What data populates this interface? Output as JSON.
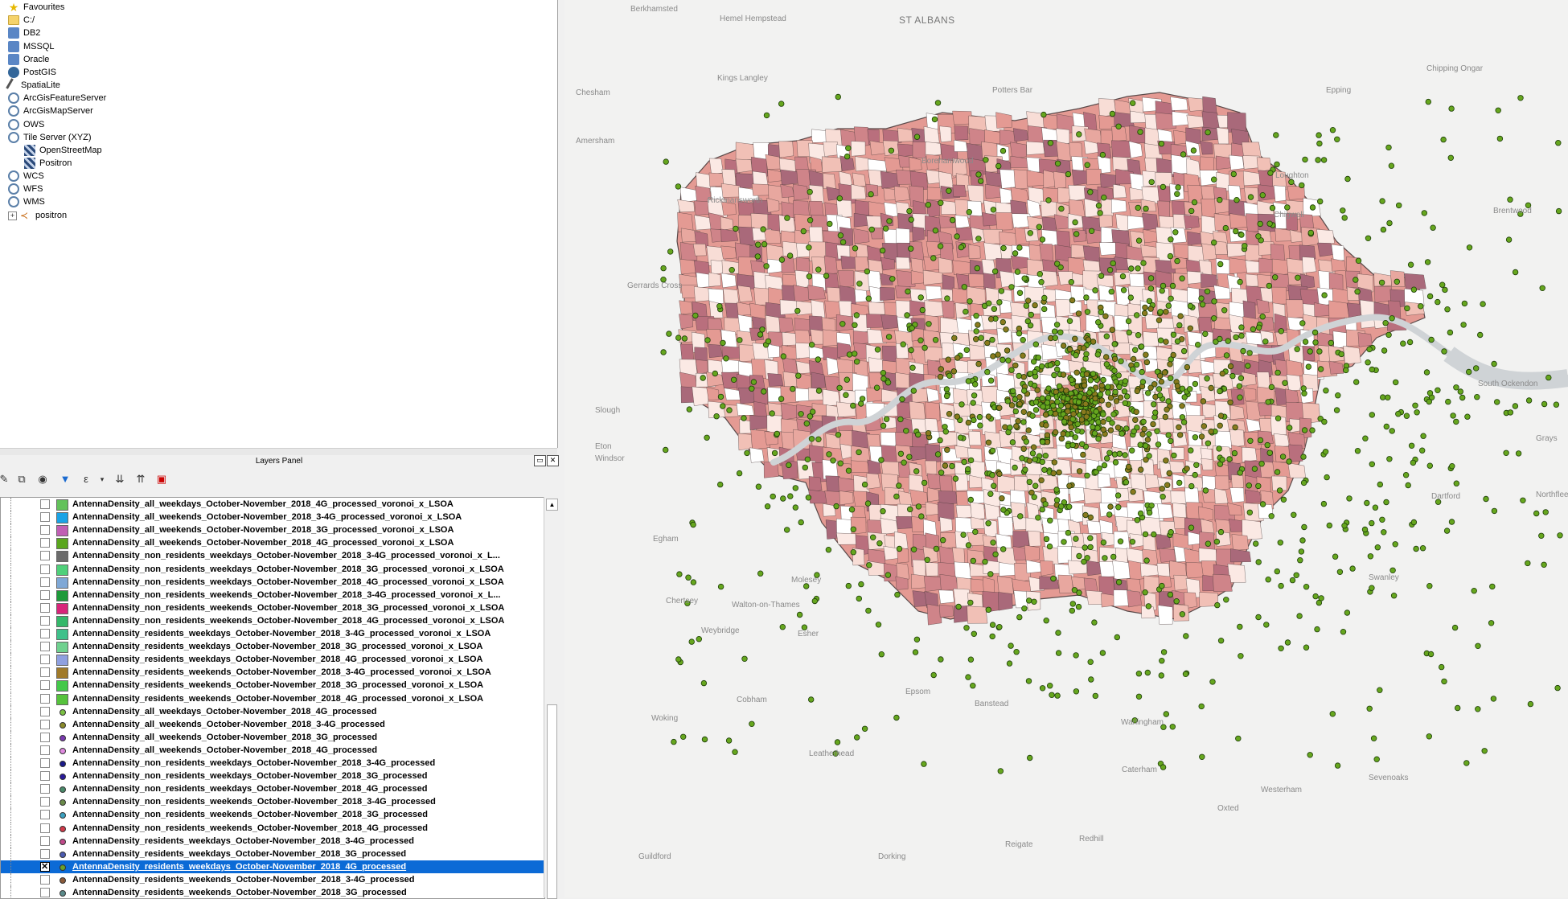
{
  "browser": {
    "items": [
      {
        "label": "Favourites",
        "icon": "star-icon"
      },
      {
        "label": "C:/",
        "icon": "folder-icon"
      },
      {
        "label": "DB2",
        "icon": "db2-icon"
      },
      {
        "label": "MSSQL",
        "icon": "mssql-icon"
      },
      {
        "label": "Oracle",
        "icon": "oracle-icon"
      },
      {
        "label": "PostGIS",
        "icon": "postgis-icon"
      },
      {
        "label": "SpatiaLite",
        "icon": "spatialite-icon"
      },
      {
        "label": "ArcGisFeatureServer",
        "icon": "arcgis-icon"
      },
      {
        "label": "ArcGisMapServer",
        "icon": "arcgis-icon"
      },
      {
        "label": "OWS",
        "icon": "globe-icon"
      },
      {
        "label": "Tile Server (XYZ)",
        "icon": "globe-icon"
      },
      {
        "label": "OpenStreetMap",
        "icon": "tile-icon"
      },
      {
        "label": "Positron",
        "icon": "tile-icon"
      },
      {
        "label": "WCS",
        "icon": "globe-icon"
      },
      {
        "label": "WFS",
        "icon": "globe-icon"
      },
      {
        "label": "WMS",
        "icon": "globe-icon"
      },
      {
        "label": "positron",
        "icon": "link-icon"
      }
    ]
  },
  "layers_panel": {
    "title": "Layers Panel",
    "rows": [
      {
        "label": "AntennaDensity_all_weekdays_October-November_2018_4G_processed_voronoi_x_LSOA",
        "swatch": "#63c25b",
        "kind": "poly",
        "checked": false
      },
      {
        "label": "AntennaDensity_all_weekends_October-November_2018_3-4G_processed_voronoi_x_LSOA",
        "swatch": "#1aa3e6",
        "kind": "poly",
        "checked": false
      },
      {
        "label": "AntennaDensity_all_weekends_October-November_2018_3G_processed_voronoi_x_LSOA",
        "swatch": "#c05fb4",
        "kind": "poly",
        "checked": false
      },
      {
        "label": "AntennaDensity_all_weekends_October-November_2018_4G_processed_voronoi_x_LSOA",
        "swatch": "#5aa61e",
        "kind": "poly",
        "checked": false
      },
      {
        "label": "AntennaDensity_non_residents_weekdays_October-November_2018_3-4G_processed_voronoi_x_L...",
        "swatch": "#6b6b6b",
        "kind": "poly",
        "checked": false
      },
      {
        "label": "AntennaDensity_non_residents_weekdays_October-November_2018_3G_processed_voronoi_x_LSOA",
        "swatch": "#4fd07a",
        "kind": "poly",
        "checked": false
      },
      {
        "label": "AntennaDensity_non_residents_weekdays_October-November_2018_4G_processed_voronoi_x_LSOA",
        "swatch": "#7fa8d6",
        "kind": "poly",
        "checked": false
      },
      {
        "label": "AntennaDensity_non_residents_weekends_October-November_2018_3-4G_processed_voronoi_x_L...",
        "swatch": "#1e9a3a",
        "kind": "poly",
        "checked": false
      },
      {
        "label": "AntennaDensity_non_residents_weekends_October-November_2018_3G_processed_voronoi_x_LSOA",
        "swatch": "#d8257a",
        "kind": "poly",
        "checked": false
      },
      {
        "label": "AntennaDensity_non_residents_weekends_October-November_2018_4G_processed_voronoi_x_LSOA",
        "swatch": "#34b86a",
        "kind": "poly",
        "checked": false
      },
      {
        "label": "AntennaDensity_residents_weekdays_October-November_2018_3-4G_processed_voronoi_x_LSOA",
        "swatch": "#3fc08a",
        "kind": "poly",
        "checked": false
      },
      {
        "label": "AntennaDensity_residents_weekdays_October-November_2018_3G_processed_voronoi_x_LSOA",
        "swatch": "#6fd18f",
        "kind": "poly",
        "checked": false
      },
      {
        "label": "AntennaDensity_residents_weekdays_October-November_2018_4G_processed_voronoi_x_LSOA",
        "swatch": "#8fa0e0",
        "kind": "poly",
        "checked": false
      },
      {
        "label": "AntennaDensity_residents_weekends_October-November_2018_3-4G_processed_voronoi_x_LSOA",
        "swatch": "#a07a2a",
        "kind": "poly",
        "checked": false
      },
      {
        "label": "AntennaDensity_residents_weekends_October-November_2018_3G_processed_voronoi_x_LSOA",
        "swatch": "#44c84a",
        "kind": "poly",
        "checked": false
      },
      {
        "label": "AntennaDensity_residents_weekends_October-November_2018_4G_processed_voronoi_x_LSOA",
        "swatch": "#56c23c",
        "kind": "poly",
        "checked": false
      },
      {
        "label": "AntennaDensity_all_weekdays_October-November_2018_4G_processed",
        "swatch": "#7bc043",
        "kind": "point",
        "checked": false
      },
      {
        "label": "AntennaDensity_all_weekends_October-November_2018_3-4G_processed",
        "swatch": "#8a8a2a",
        "kind": "point",
        "checked": false
      },
      {
        "label": "AntennaDensity_all_weekends_October-November_2018_3G_processed",
        "swatch": "#7a3ab0",
        "kind": "point",
        "checked": false
      },
      {
        "label": "AntennaDensity_all_weekends_October-November_2018_4G_processed",
        "swatch": "#e08ae0",
        "kind": "point",
        "checked": false
      },
      {
        "label": "AntennaDensity_non_residents_weekdays_October-November_2018_3-4G_processed",
        "swatch": "#1a1a8a",
        "kind": "point",
        "checked": false
      },
      {
        "label": "AntennaDensity_non_residents_weekdays_October-November_2018_3G_processed",
        "swatch": "#2a1a9a",
        "kind": "point",
        "checked": false
      },
      {
        "label": "AntennaDensity_non_residents_weekdays_October-November_2018_4G_processed",
        "swatch": "#4a8a6a",
        "kind": "point",
        "checked": false
      },
      {
        "label": "AntennaDensity_non_residents_weekends_October-November_2018_3-4G_processed",
        "swatch": "#6a8a4a",
        "kind": "point",
        "checked": false
      },
      {
        "label": "AntennaDensity_non_residents_weekends_October-November_2018_3G_processed",
        "swatch": "#3aa0c0",
        "kind": "point",
        "checked": false
      },
      {
        "label": "AntennaDensity_non_residents_weekends_October-November_2018_4G_processed",
        "swatch": "#d03a4a",
        "kind": "point",
        "checked": false
      },
      {
        "label": "AntennaDensity_residents_weekdays_October-November_2018_3-4G_processed",
        "swatch": "#c04a8a",
        "kind": "point",
        "checked": false
      },
      {
        "label": "AntennaDensity_residents_weekdays_October-November_2018_3G_processed",
        "swatch": "#4a5ab0",
        "kind": "point",
        "checked": false
      },
      {
        "label": "AntennaDensity_residents_weekdays_October-November_2018_4G_processed",
        "swatch": "#6aa02a",
        "kind": "point",
        "checked": true,
        "selected": true
      },
      {
        "label": "AntennaDensity_residents_weekends_October-November_2018_3-4G_processed",
        "swatch": "#8a5a3a",
        "kind": "point",
        "checked": false
      },
      {
        "label": "AntennaDensity_residents_weekends_October-November_2018_3G_processed",
        "swatch": "#5a8a8a",
        "kind": "point",
        "checked": false
      }
    ]
  },
  "map": {
    "colors": {
      "background": "#f2f2f1",
      "polygon_light": "#f8ddd6",
      "polygon_mid": "#e49a93",
      "polygon_dark": "#b96f7d",
      "river": "#cfd3d6",
      "point_fill": "#66a61e",
      "point_stroke": "#1d3d08"
    },
    "place_labels": [
      "Berkhamsted",
      "Hemel Hempstead",
      "ST ALBANS",
      "Kings Langley",
      "Potters Bar",
      "Chipping Ongar",
      "Chesham",
      "Epping",
      "Amersham",
      "Borehamwood",
      "Loughton",
      "Rickmansworth",
      "Chigwell",
      "Brentwood",
      "Gerrards Cross",
      "Slough",
      "Eton",
      "Windsor",
      "Egham",
      "Chertsey",
      "Walton-on-Thames",
      "Molesey",
      "Esher",
      "Weybridge",
      "Cobham",
      "Woking",
      "Epsom",
      "Banstead",
      "Warlingham",
      "Caterham",
      "Leatherhead",
      "Westerham",
      "Sevenoaks",
      "Swanley",
      "Oxted",
      "Redhill",
      "Reigate",
      "Dorking",
      "Guildford",
      "Dartford",
      "South Ockendon",
      "Northfleet",
      "Grays"
    ]
  }
}
